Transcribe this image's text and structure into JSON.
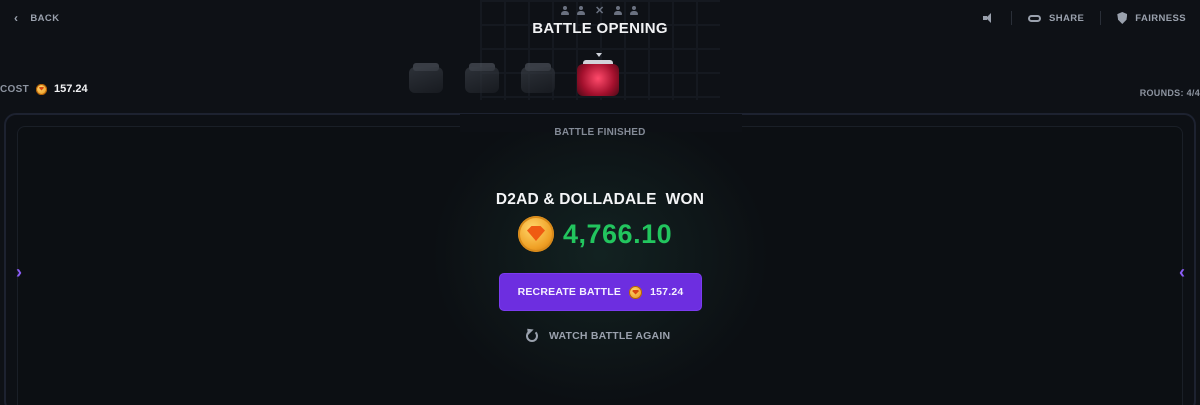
{
  "header": {
    "back_label": "BACK",
    "title": "BATTLE OPENING",
    "share_label": "SHARE",
    "fairness_label": "FAIRNESS",
    "vs_symbol": "✕"
  },
  "summary": {
    "cost_label": "COST",
    "cost_value": "157.24",
    "rounds_label": "ROUNDS: 4/4"
  },
  "cases": [
    {
      "name": "case-1"
    },
    {
      "name": "case-2"
    },
    {
      "name": "case-3"
    },
    {
      "name": "case-4",
      "active": true
    }
  ],
  "result": {
    "status": "BATTLE FINISHED",
    "winner_text": "D2AD & DOLLADALE  WON",
    "prize_amount": "4,766.10",
    "recreate_label": "RECREATE BATTLE",
    "recreate_price": "157.24",
    "watch_again_label": "WATCH BATTLE AGAIN"
  },
  "nav": {
    "left_arrow": "‹",
    "right_arrow": "‹"
  },
  "colors": {
    "accent_purple": "#6d2ee0",
    "prize_green": "#22c55e",
    "coin_orange": "#f0a126"
  }
}
